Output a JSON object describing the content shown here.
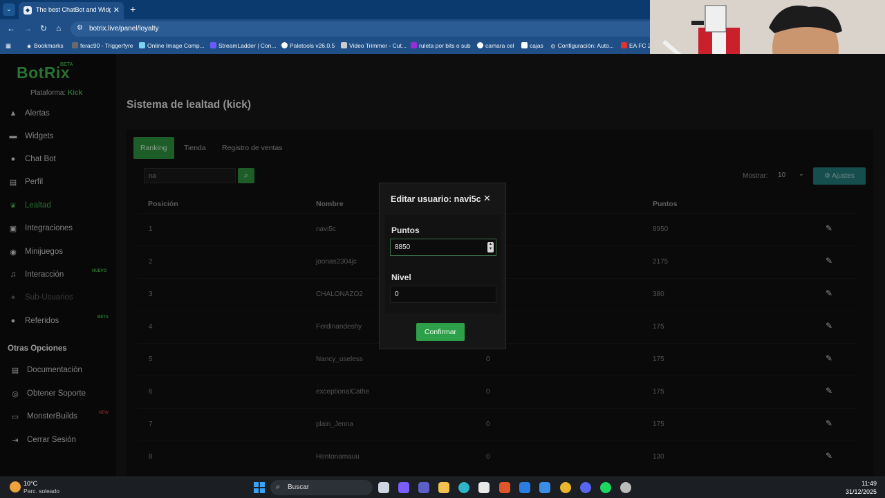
{
  "browser": {
    "tab_title": "The best ChatBot and Widgets",
    "url": "botrix.live/panel/loyalty",
    "bookmarks": [
      {
        "label": "Bookmarks",
        "color": "#ffffff"
      },
      {
        "label": "ferac90 - Triggerfyre",
        "color": "#6a6a6a"
      },
      {
        "label": "Online Image Comp...",
        "color": "#7dd3f0"
      },
      {
        "label": "StreamLadder | Con...",
        "color": "#6b5cff"
      },
      {
        "label": "Paletools v26.0.5",
        "color": "#ffffff"
      },
      {
        "label": "Video Trimmer - Cut...",
        "color": "#cccccc"
      },
      {
        "label": "ruleta por bits o sub",
        "color": "#9b2bd6"
      },
      {
        "label": "camara cel",
        "color": "#ffffff"
      },
      {
        "label": "cajas",
        "color": "#ffffff"
      },
      {
        "label": "Configuración: Auto...",
        "color": "#dddddd"
      },
      {
        "label": "EA FC 2",
        "color": "#d33"
      }
    ]
  },
  "sidebar": {
    "logo": "BotRix",
    "logo_badge": "BETA",
    "platform_label": "Plataforma:",
    "platform_value": "Kick",
    "items": [
      {
        "label": "Alertas",
        "icon": "warning-icon",
        "glyph": "▲"
      },
      {
        "label": "Widgets",
        "icon": "widgets-icon",
        "glyph": "▬"
      },
      {
        "label": "Chat Bot",
        "icon": "robot-icon",
        "glyph": "●"
      },
      {
        "label": "Perfil",
        "icon": "profile-card-icon",
        "glyph": "▤"
      },
      {
        "label": "Lealtad",
        "icon": "leaf-icon",
        "glyph": "❦"
      },
      {
        "label": "Integraciones",
        "icon": "integrations-icon",
        "glyph": "▣"
      },
      {
        "label": "Minijuegos",
        "icon": "gamepad-icon",
        "glyph": "◉"
      },
      {
        "label": "Interacción",
        "icon": "music-icon",
        "glyph": "♫"
      },
      {
        "label": "Sub-Usuarios",
        "icon": "users-icon",
        "glyph": "●"
      },
      {
        "label": "Referidos",
        "icon": "referral-icon",
        "glyph": "●"
      }
    ],
    "badge_nuevo": "NUEVO",
    "badge_beta": "BETA",
    "other_title": "Otras Opciones",
    "other_items": [
      {
        "label": "Documentación",
        "icon": "document-icon",
        "glyph": "▤"
      },
      {
        "label": "Obtener Soporte",
        "icon": "support-icon",
        "glyph": "◎"
      },
      {
        "label": "MonsterBuilds",
        "icon": "monitor-icon",
        "glyph": "▭"
      },
      {
        "label": "Cerrar Sesión",
        "icon": "logout-icon",
        "glyph": "⇥"
      }
    ],
    "badge_new_red": "NEW"
  },
  "main": {
    "title": "Sistema de lealtad (kick)",
    "tabs": [
      "Ranking",
      "Tienda",
      "Registro de ventas"
    ],
    "search_value": "na",
    "show_label": "Mostrar:",
    "show_value": "10",
    "settings_label": "Ajustes",
    "columns": [
      "Posición",
      "Nombre",
      "Puntos"
    ],
    "rows": [
      {
        "pos": "1",
        "name": "navi5c",
        "level": "",
        "points": "8950"
      },
      {
        "pos": "2",
        "name": "joonas2304jc",
        "level": "",
        "points": "2175"
      },
      {
        "pos": "3",
        "name": "CHALONAZO2",
        "level": "",
        "points": "380"
      },
      {
        "pos": "4",
        "name": "Ferdinandeshy",
        "level": "",
        "points": "175"
      },
      {
        "pos": "5",
        "name": "Nancy_useless",
        "level": "0",
        "points": "175"
      },
      {
        "pos": "6",
        "name": "exceptionalCathe",
        "level": "0",
        "points": "175"
      },
      {
        "pos": "7",
        "name": "plain_Jenna",
        "level": "0",
        "points": "175"
      },
      {
        "pos": "8",
        "name": "Hentonamauu",
        "level": "0",
        "points": "130"
      }
    ]
  },
  "modal": {
    "title": "Editar usuario: navi5c",
    "points_label": "Puntos",
    "points_value": "8850",
    "level_label": "Nivel",
    "level_value": "0",
    "confirm_label": "Confirmar"
  },
  "taskbar": {
    "temp": "10°C",
    "weather": "Parc. soleado",
    "search_label": "Buscar",
    "time": "11:49",
    "date": "31/12/2025",
    "apps": [
      {
        "name": "task-view-icon",
        "color": "#cfd6df"
      },
      {
        "name": "copilot-icon",
        "color": "#7a5cff"
      },
      {
        "name": "teams-icon",
        "color": "#5b5fc7"
      },
      {
        "name": "file-explorer-icon",
        "color": "#f2c14e"
      },
      {
        "name": "edge-icon",
        "color": "#2fb5c8"
      },
      {
        "name": "store-icon",
        "color": "#e8e8e8"
      },
      {
        "name": "app-orange-icon",
        "color": "#e0562c"
      },
      {
        "name": "mail-icon",
        "color": "#2a7de1"
      },
      {
        "name": "photos-icon",
        "color": "#3a8ee6"
      },
      {
        "name": "chrome-icon",
        "color": "#e8b52c"
      },
      {
        "name": "discord-icon",
        "color": "#5865f2"
      },
      {
        "name": "spotify-icon",
        "color": "#1ed760"
      },
      {
        "name": "obs-icon",
        "color": "#bbbbbb"
      }
    ]
  },
  "colors": {
    "brand_green": "#3ea84a",
    "confirm_green": "#2fa04a",
    "settings_teal": "#1f7470",
    "browser_blue": "#1f4f86"
  }
}
